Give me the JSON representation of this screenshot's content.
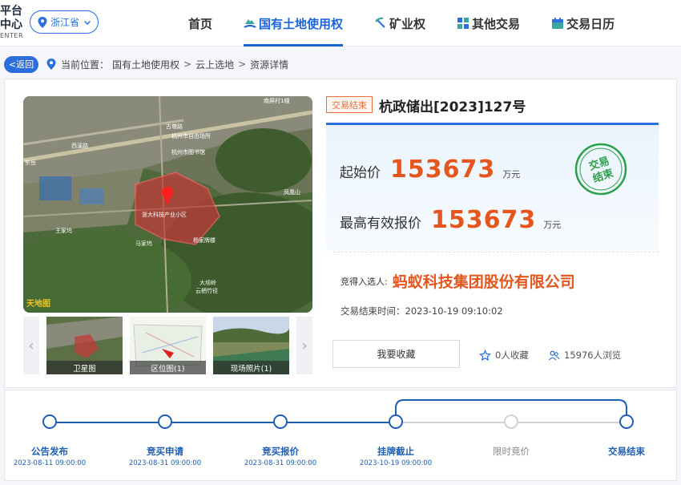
{
  "logo": {
    "line1": "平台",
    "line2": "中心",
    "line3": "ENTER"
  },
  "province": {
    "label": "浙江省"
  },
  "nav": {
    "items": [
      {
        "label": "首页"
      },
      {
        "label": "国有土地使用权"
      },
      {
        "label": "矿业权"
      },
      {
        "label": "其他交易"
      },
      {
        "label": "交易日历"
      }
    ]
  },
  "breadcrumb": {
    "back_label": "返回",
    "prefix": "当前位置：",
    "items": [
      "国有土地使用权",
      "云上选地",
      "资源详情"
    ]
  },
  "map": {
    "labels": [
      "南屏村1幢",
      "古墩路",
      "杭州市自由场所",
      "杭州市图书馆",
      "西溪路",
      "浙大科技产业小区",
      "王家坞",
      "马家坞",
      "凤凰山",
      "大坝岭",
      "东岳",
      "杨家牌楼",
      "云栖竹径"
    ],
    "watermark": "天地图"
  },
  "thumbnails": [
    {
      "label": "卫星图"
    },
    {
      "label": "区位图(1)"
    },
    {
      "label": "现场照片(1)"
    }
  ],
  "listing": {
    "status_tag": "交易结束",
    "title": "杭政储出[2023]127号",
    "start_price_label": "起始价",
    "start_price": "153673",
    "start_price_unit": "万元",
    "top_bid_label": "最高有效报价",
    "top_bid": "153673",
    "top_bid_unit": "万元",
    "stamp_text_1": "交易",
    "stamp_text_2": "结束",
    "winner_label": "竞得入选人:",
    "winner_name": "蚂蚁科技集团股份有限公司",
    "end_time": "交易结束时间：2023-10-19 09:10:02",
    "favorite_button": "我要收藏",
    "favorites": "0人收藏",
    "views": "15976人浏览"
  },
  "timeline": {
    "steps": [
      {
        "label": "公告发布",
        "date": "2023-08-11 09:00:00",
        "done": true
      },
      {
        "label": "竞买申请",
        "date": "2023-08-31 09:00:00",
        "done": true
      },
      {
        "label": "竞买报价",
        "date": "2023-08-31 09:00:00",
        "done": true
      },
      {
        "label": "挂牌截止",
        "date": "2023-10-19 09:00:00",
        "done": true
      },
      {
        "label": "限时竞价",
        "date": "",
        "done": false
      },
      {
        "label": "交易结束",
        "date": "",
        "done": true
      }
    ]
  },
  "colors": {
    "accent": "#1d63d8",
    "price": "#e4561e",
    "stamp": "#2aa04a",
    "timeline": "#1e5fb4"
  }
}
